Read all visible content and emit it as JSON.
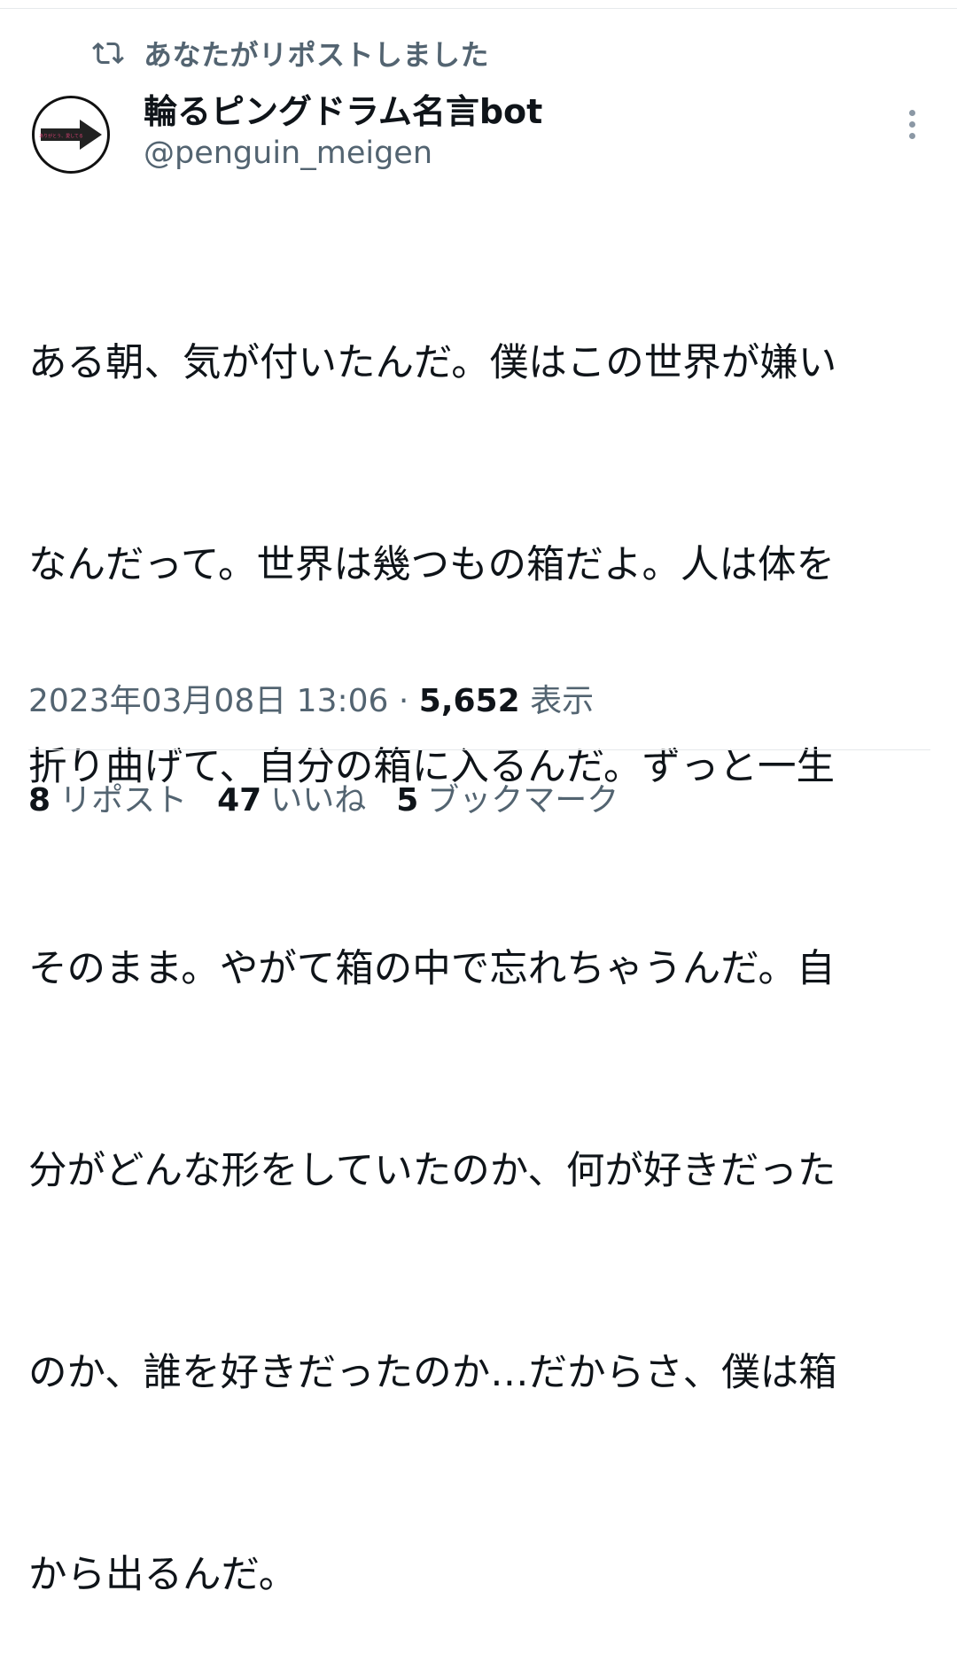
{
  "repost_banner": {
    "text": "あなたがリポストしました",
    "icon": "repost-icon"
  },
  "author": {
    "name": "輪るピングドラム名言bot",
    "handle": "@penguin_meigen",
    "avatar_caption": "ありがとう、愛してる",
    "avatar_icon": "arrow-right-icon"
  },
  "tweet": {
    "lines": [
      "ある朝、気が付いたんだ。僕はこの世界が嫌い",
      "なんだって。世界は幾つもの箱だよ。人は体を",
      "折り曲げて、自分の箱に入るんだ。ずっと一生",
      "そのまま。やがて箱の中で忘れちゃうんだ。自",
      "分がどんな形をしていたのか、何が好きだった",
      "のか、誰を好きだったのか…だからさ、僕は箱",
      "から出るんだ。"
    ]
  },
  "meta": {
    "timestamp": "2023年03月08日 13:06",
    "separator": " · ",
    "views": "5,652",
    "views_label": "表示"
  },
  "stats": {
    "reposts": {
      "count": "8",
      "label": "リポスト"
    },
    "likes": {
      "count": "47",
      "label": "いいね"
    },
    "bookmarks": {
      "count": "5",
      "label": "ブックマーク"
    }
  },
  "colors": {
    "text_primary": "#0f1419",
    "text_secondary": "#536471",
    "divider": "#e6e9eb",
    "avatar_arrow_label": "#d64072"
  }
}
